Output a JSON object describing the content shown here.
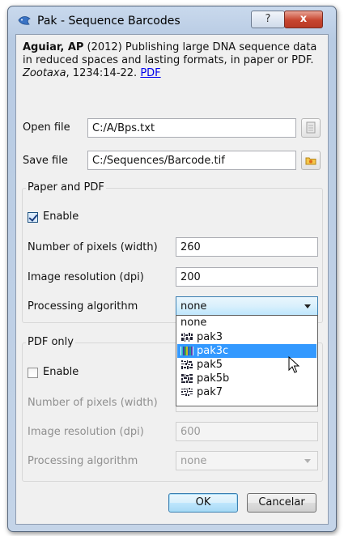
{
  "window": {
    "title": "Pak - Sequence Barcodes",
    "help_label": "?",
    "close_label": "x"
  },
  "citation": {
    "authors": "Aguiar, AP",
    "text": "(2012) Publishing large DNA sequence data in reduced spaces and lasting formats, in paper or PDF.",
    "journal": "Zootaxa",
    "pages": ", 1234:14-22.",
    "link": "PDF"
  },
  "open_file": {
    "label": "Open file",
    "value": "C:/A/Bps.txt"
  },
  "save_file": {
    "label": "Save file",
    "value": "C:/Sequences/Barcode.tif"
  },
  "paper_pdf": {
    "title": "Paper and PDF",
    "enable_label": "Enable",
    "enabled": true,
    "pixels_label": "Number of pixels (width)",
    "pixels_value": "260",
    "resolution_label": "Image resolution (dpi)",
    "resolution_value": "200",
    "algorithm_label": "Processing algorithm",
    "algorithm_value": "none"
  },
  "dropdown": {
    "options": [
      {
        "label": "none",
        "icon": null
      },
      {
        "label": "pak3",
        "icon": "barcode-pak3-icon"
      },
      {
        "label": "pak3c",
        "icon": "barcode-pak3c-icon",
        "highlighted": true
      },
      {
        "label": "pak5",
        "icon": "barcode-pak5-icon"
      },
      {
        "label": "pak5b",
        "icon": "barcode-pak5b-icon"
      },
      {
        "label": "pak7",
        "icon": "barcode-pak7-icon"
      }
    ]
  },
  "pdf_only": {
    "title": "PDF only",
    "enable_label": "Enable",
    "enabled": false,
    "pixels_label": "Number of pixels (width)",
    "resolution_label": "Image resolution (dpi)",
    "resolution_value": "600",
    "algorithm_label": "Processing algorithm",
    "algorithm_value": "none"
  },
  "buttons": {
    "ok": "OK",
    "cancel": "Cancelar"
  },
  "colors": {
    "selection": "#3399ff",
    "close_button": "#c7452f",
    "link": "#0000ee"
  }
}
